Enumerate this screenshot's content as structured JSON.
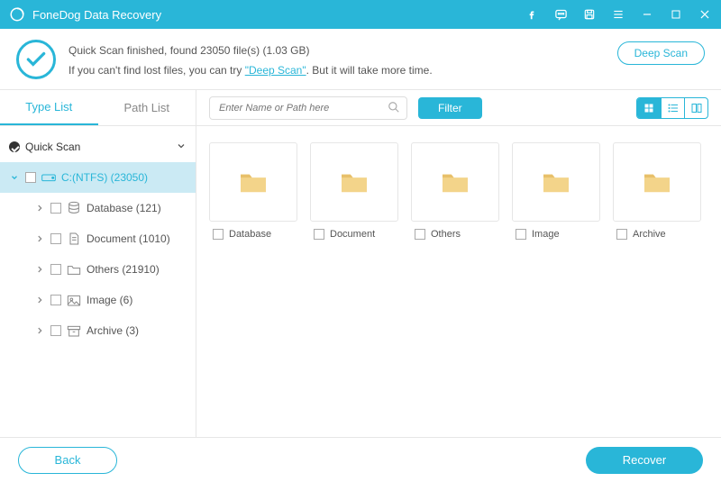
{
  "app": {
    "title": "FoneDog Data Recovery"
  },
  "titlebar_icons": [
    "facebook-icon",
    "feedback-icon",
    "save-icon",
    "menu-icon",
    "minimize-icon",
    "maximize-icon",
    "close-icon"
  ],
  "status": {
    "line1_prefix": "Quick Scan finished, found ",
    "file_count": "23050",
    "line1_mid": " file(s) ",
    "size": "(1.03 GB)",
    "line2_prefix": "If you can't find lost files, you can try ",
    "deep_link": "\"Deep Scan\"",
    "line2_suffix": ". But it will take more time.",
    "deep_scan_btn": "Deep Scan"
  },
  "tabs": {
    "type_list": "Type List",
    "path_list": "Path List"
  },
  "tree": {
    "quick_scan": "Quick Scan",
    "drive": "C:(NTFS) (23050)",
    "children": [
      {
        "label": "Database (121)",
        "icon": "database-icon"
      },
      {
        "label": "Document (1010)",
        "icon": "document-icon"
      },
      {
        "label": "Others (21910)",
        "icon": "folder-icon"
      },
      {
        "label": "Image (6)",
        "icon": "image-icon"
      },
      {
        "label": "Archive (3)",
        "icon": "archive-icon"
      }
    ]
  },
  "toolbar": {
    "search_placeholder": "Enter Name or Path here",
    "filter": "Filter"
  },
  "folders": [
    {
      "label": "Database"
    },
    {
      "label": "Document"
    },
    {
      "label": "Others"
    },
    {
      "label": "Image"
    },
    {
      "label": "Archive"
    }
  ],
  "footer": {
    "back": "Back",
    "recover": "Recover"
  },
  "colors": {
    "accent": "#29b6d8"
  }
}
